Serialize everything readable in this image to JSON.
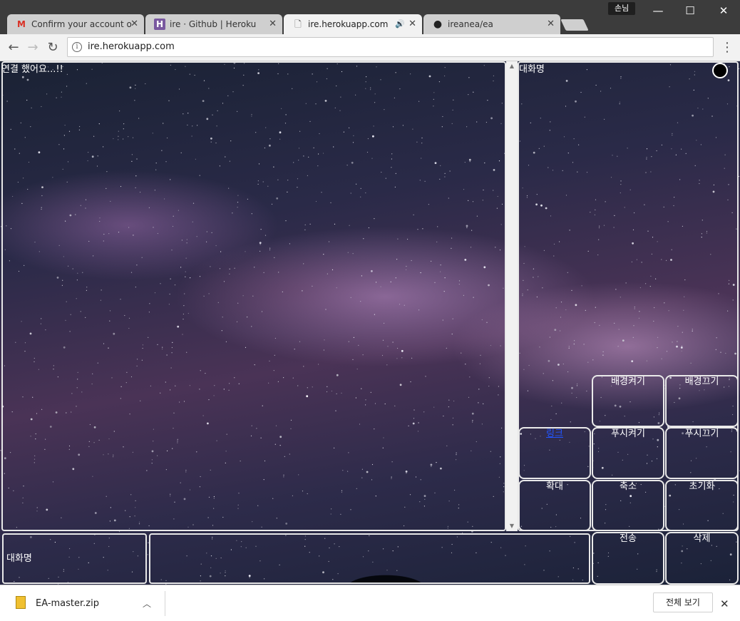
{
  "window": {
    "profile_label": "손님",
    "minimize_glyph": "—",
    "maximize_glyph": "☐",
    "close_glyph": "✕"
  },
  "tabs": [
    {
      "title": "Confirm your account o",
      "favicon": "gmail-icon",
      "favicon_glyph": "M",
      "favicon_color": "#d93025"
    },
    {
      "title": "ire · Github | Heroku",
      "favicon": "heroku-icon",
      "favicon_glyph": "H",
      "favicon_color": "#79589f"
    },
    {
      "title": "ire.herokuapp.com",
      "favicon": "page-icon",
      "favicon_glyph": "🗋",
      "active": true,
      "audio": true
    },
    {
      "title": "ireanea/ea",
      "favicon": "github-icon",
      "favicon_glyph": "●",
      "favicon_color": "#222"
    }
  ],
  "toolbar": {
    "back_glyph": "←",
    "forward_glyph": "→",
    "reload_glyph": "↻",
    "info_glyph": "i",
    "url": "ire.herokuapp.com",
    "menu_glyph": "⋮"
  },
  "page": {
    "status_text": "연결 했어요...!!",
    "side_title": "대화명",
    "buttons": {
      "bg_on": "배경켜기",
      "bg_off": "배경끄기",
      "link": "링크",
      "push_on": "푸시켜기",
      "push_off": "푸시끄기",
      "zoom_in": "확대",
      "zoom_out": "축소",
      "reset": "초기화",
      "send": "전송",
      "delete": "삭제"
    },
    "name_box_label": "대화명"
  },
  "download_bar": {
    "file_name": "EA-master.zip",
    "chevron_glyph": "︿",
    "show_all_label": "전체 보기",
    "close_glyph": "✕"
  }
}
